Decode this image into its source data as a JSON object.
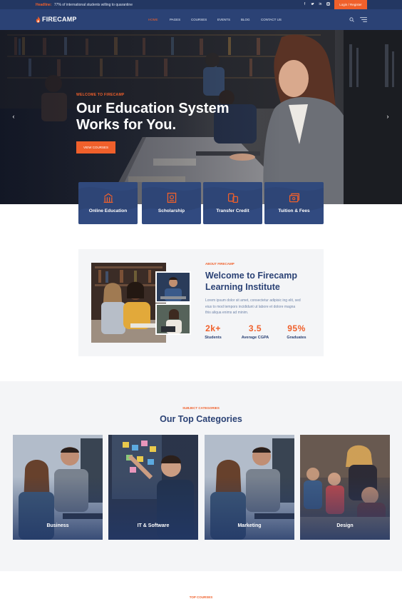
{
  "topbar": {
    "headline_tag": "Headline:",
    "headline_text": "77% of international students willing to quarantine",
    "social_icons": [
      "facebook-icon",
      "twitter-icon",
      "linkedin-icon",
      "instagram-icon"
    ],
    "login_label": "Login / Register"
  },
  "header": {
    "logo_text": "FIRECAMP",
    "nav": [
      {
        "label": "HOME",
        "active": true
      },
      {
        "label": "PAGES",
        "active": false
      },
      {
        "label": "COURSES",
        "active": false
      },
      {
        "label": "EVENTS",
        "active": false
      },
      {
        "label": "BLOG",
        "active": false
      },
      {
        "label": "CONTACT US",
        "active": false
      }
    ]
  },
  "hero": {
    "kicker": "WELCOME TO FIRECAMP",
    "title_line1": "Our Education System",
    "title_line2": "Works for You.",
    "cta_label": "VIEW COURSES",
    "prev_icon": "chevron-left-icon",
    "next_icon": "chevron-right-icon"
  },
  "features": [
    {
      "label": "Online Education",
      "icon": "building-icon"
    },
    {
      "label": "Scholarship",
      "icon": "certificate-icon"
    },
    {
      "label": "Transfer Credit",
      "icon": "devices-icon"
    },
    {
      "label": "Tuition & Fees",
      "icon": "money-icon"
    }
  ],
  "about": {
    "kicker": "ABOUT FIRECAMP",
    "title_line1": "Welcome to Firecamp",
    "title_line2": "Learning Institute",
    "description": "Lorem ipsum dolor sit amet, consectetur adipisic ing elit, sed eius to mod tempors incididunt ut labore et dolore magna this aliqua enims ad minim.",
    "stats": [
      {
        "value": "2k+",
        "label": "Students"
      },
      {
        "value": "3.5",
        "label": "Average CGPA"
      },
      {
        "value": "95%",
        "label": "Graduates"
      }
    ]
  },
  "categories": {
    "kicker": "SUBJECT CATEGORIES",
    "title": "Our Top Categories",
    "items": [
      {
        "label": "Business"
      },
      {
        "label": "IT & Software"
      },
      {
        "label": "Marketing"
      },
      {
        "label": "Design"
      }
    ]
  },
  "courses": {
    "kicker": "TOP COURSES"
  },
  "colors": {
    "accent": "#f0602b",
    "navy": "#2b4275",
    "topbar": "#233762",
    "light_bg": "#f4f5f7"
  }
}
